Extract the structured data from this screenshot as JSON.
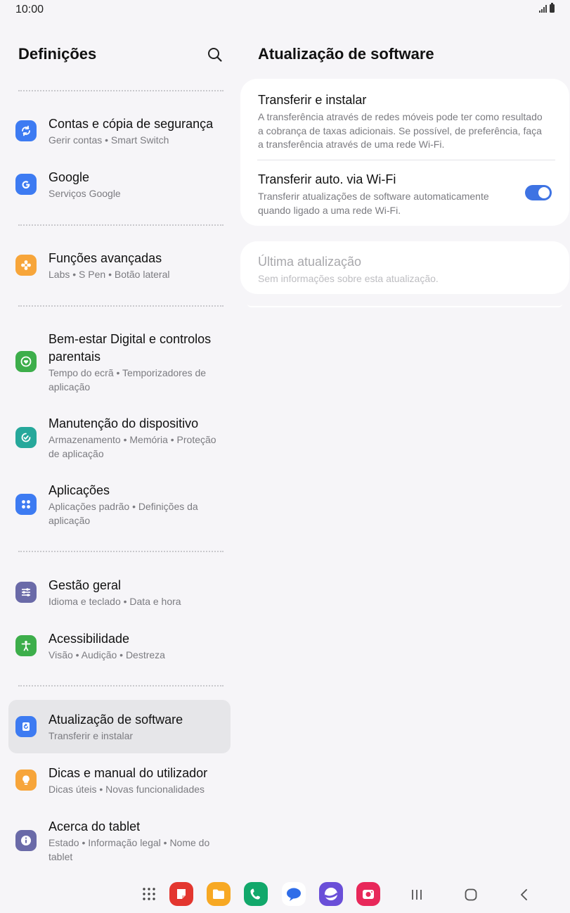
{
  "status_bar": {
    "time": "10:00",
    "signal_icon": "signal-icon",
    "battery_icon": "battery-icon"
  },
  "left_panel": {
    "title": "Definições",
    "search_icon": "search-icon",
    "items": [
      {
        "title": "Contas e cópia de segurança",
        "subtitle": "Gerir contas • Smart Switch",
        "icon": "sync-icon",
        "color": "#3d7bf2"
      },
      {
        "title": "Google",
        "subtitle": "Serviços Google",
        "icon": "google-icon",
        "color": "#3d7bf2"
      },
      {
        "title": "Funções avançadas",
        "subtitle": "Labs • S Pen • Botão lateral",
        "icon": "puzzle-star-icon",
        "color": "#f7a53a"
      },
      {
        "title": "Bem-estar Digital e controlos parentais",
        "subtitle": "Tempo do ecrã • Temporizadores de aplicação",
        "icon": "wellbeing-heart-icon",
        "color": "#3dae4b"
      },
      {
        "title": "Manutenção do dispositivo",
        "subtitle": "Armazenamento • Memória • Proteção de aplicação",
        "icon": "device-care-icon",
        "color": "#26a89b"
      },
      {
        "title": "Aplicações",
        "subtitle": "Aplicações padrão • Definições da aplicação",
        "icon": "apps-grid-icon",
        "color": "#3d7bf2"
      },
      {
        "title": "Gestão geral",
        "subtitle": "Idioma e teclado • Data e hora",
        "icon": "sliders-icon",
        "color": "#6a6aa8"
      },
      {
        "title": "Acessibilidade",
        "subtitle": "Visão • Audição • Destreza",
        "icon": "accessibility-icon",
        "color": "#3dae4b"
      },
      {
        "title": "Atualização de software",
        "subtitle": "Transferir e instalar",
        "icon": "software-update-icon",
        "color": "#3d7bf2"
      },
      {
        "title": "Dicas e manual do utilizador",
        "subtitle": "Dicas úteis • Novas funcionalidades",
        "icon": "lightbulb-icon",
        "color": "#f7a53a"
      },
      {
        "title": "Acerca do tablet",
        "subtitle": "Estado • Informação legal • Nome do tablet",
        "icon": "info-icon",
        "color": "#6a6aa8"
      }
    ]
  },
  "right_panel": {
    "title": "Atualização de software",
    "download_install": {
      "title": "Transferir e instalar",
      "subtitle": "A transferência através de redes móveis pode ter como resultado a cobrança de taxas adicionais. Se possível, de preferência, faça a transferência através de uma rede Wi-Fi."
    },
    "auto_wifi": {
      "title": "Transferir auto. via Wi-Fi",
      "subtitle": "Transferir atualizações de software automaticamente quando ligado a uma rede Wi-Fi.",
      "toggle_on": true,
      "accent": "#3e73e3"
    },
    "last_update": {
      "title": "Última atualização",
      "subtitle": "Sem informações sobre esta atualização."
    }
  },
  "dock": {
    "apps": [
      {
        "icon": "app-drawer-icon"
      },
      {
        "icon": "samsung-notes-icon",
        "color": "#e3362f"
      },
      {
        "icon": "my-files-icon",
        "color": "#f7a823"
      },
      {
        "icon": "phone-icon",
        "color": "#12a86b"
      },
      {
        "icon": "messages-icon",
        "color": "#2f6de8"
      },
      {
        "icon": "samsung-internet-icon",
        "color": "#6a4fd8"
      },
      {
        "icon": "camera-icon",
        "color": "#e8285a"
      }
    ],
    "nav": [
      "recents-icon",
      "home-icon",
      "back-icon"
    ]
  }
}
